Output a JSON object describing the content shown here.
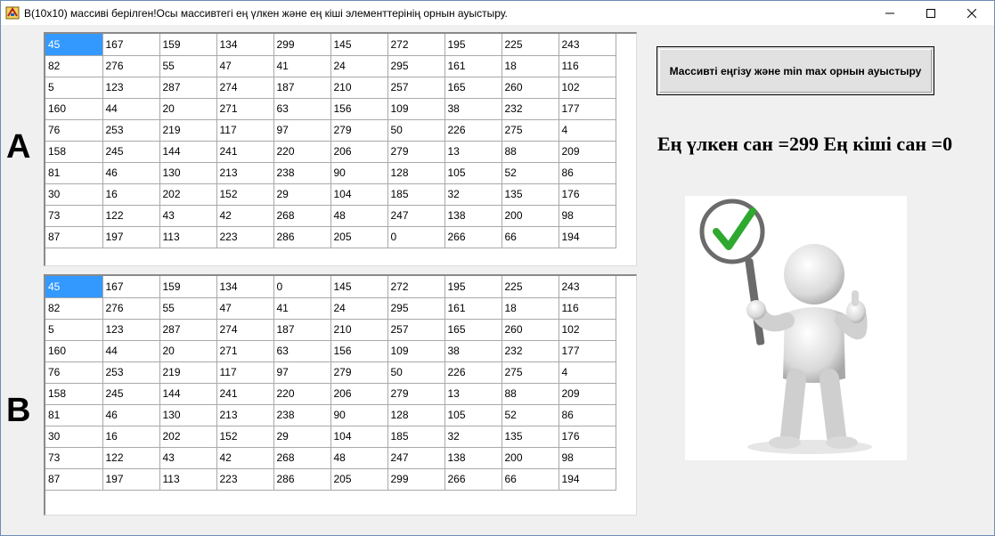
{
  "window": {
    "title": "B(10x10) массиві берілген!Осы массивтегі ең үлкен және ең кіші элементтерінің орнын ауыстыру.",
    "icons": {
      "app": "app-icon",
      "minimize": "minimize-icon",
      "maximize": "maximize-icon",
      "close": "close-icon"
    }
  },
  "labels": {
    "a": "A",
    "b": "B"
  },
  "grid_a": [
    [
      "45",
      "167",
      "159",
      "134",
      "299",
      "145",
      "272",
      "195",
      "225",
      "243"
    ],
    [
      "82",
      "276",
      "55",
      "47",
      "41",
      "24",
      "295",
      "161",
      "18",
      "116"
    ],
    [
      "5",
      "123",
      "287",
      "274",
      "187",
      "210",
      "257",
      "165",
      "260",
      "102"
    ],
    [
      "160",
      "44",
      "20",
      "271",
      "63",
      "156",
      "109",
      "38",
      "232",
      "177"
    ],
    [
      "76",
      "253",
      "219",
      "117",
      "97",
      "279",
      "50",
      "226",
      "275",
      "4"
    ],
    [
      "158",
      "245",
      "144",
      "241",
      "220",
      "206",
      "279",
      "13",
      "88",
      "209"
    ],
    [
      "81",
      "46",
      "130",
      "213",
      "238",
      "90",
      "128",
      "105",
      "52",
      "86"
    ],
    [
      "30",
      "16",
      "202",
      "152",
      "29",
      "104",
      "185",
      "32",
      "135",
      "176"
    ],
    [
      "73",
      "122",
      "43",
      "42",
      "268",
      "48",
      "247",
      "138",
      "200",
      "98"
    ],
    [
      "87",
      "197",
      "113",
      "223",
      "286",
      "205",
      "0",
      "266",
      "66",
      "194"
    ]
  ],
  "grid_b": [
    [
      "45",
      "167",
      "159",
      "134",
      "0",
      "145",
      "272",
      "195",
      "225",
      "243"
    ],
    [
      "82",
      "276",
      "55",
      "47",
      "41",
      "24",
      "295",
      "161",
      "18",
      "116"
    ],
    [
      "5",
      "123",
      "287",
      "274",
      "187",
      "210",
      "257",
      "165",
      "260",
      "102"
    ],
    [
      "160",
      "44",
      "20",
      "271",
      "63",
      "156",
      "109",
      "38",
      "232",
      "177"
    ],
    [
      "76",
      "253",
      "219",
      "117",
      "97",
      "279",
      "50",
      "226",
      "275",
      "4"
    ],
    [
      "158",
      "245",
      "144",
      "241",
      "220",
      "206",
      "279",
      "13",
      "88",
      "209"
    ],
    [
      "81",
      "46",
      "130",
      "213",
      "238",
      "90",
      "128",
      "105",
      "52",
      "86"
    ],
    [
      "30",
      "16",
      "202",
      "152",
      "29",
      "104",
      "185",
      "32",
      "135",
      "176"
    ],
    [
      "73",
      "122",
      "43",
      "42",
      "268",
      "48",
      "247",
      "138",
      "200",
      "98"
    ],
    [
      "87",
      "197",
      "113",
      "223",
      "286",
      "205",
      "299",
      "266",
      "66",
      "194"
    ]
  ],
  "selected_cell": {
    "row": 0,
    "col": 0
  },
  "action_button": {
    "label": "Массивті еңгізу және min max орнын ауыстыру"
  },
  "result": {
    "text": "Ең үлкен сан =299 Ең кіші сан =0"
  },
  "picture": {
    "icon": "checkmark-person-illustration"
  },
  "colors": {
    "selection": "#3399ff",
    "check": "#2fa82f"
  }
}
